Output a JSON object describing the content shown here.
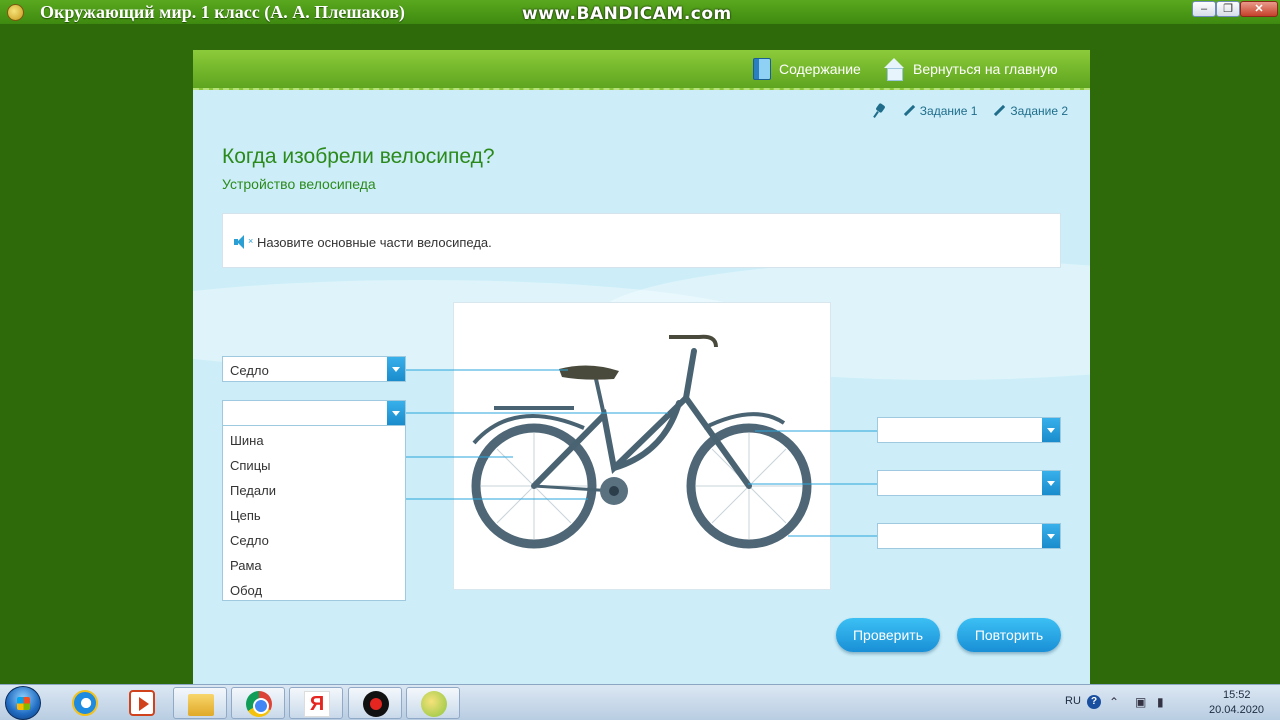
{
  "window": {
    "title": "Окружающий мир. 1 класс (А. А. Плешаков)",
    "watermark": "www.BANDICAM.com",
    "controls": {
      "minimize": "–",
      "maximize": "❐",
      "close": "✕"
    }
  },
  "header": {
    "contents_label": "Содержание",
    "home_label": "Вернуться на главную"
  },
  "task_nav": {
    "items": [
      {
        "label": "Задание 1"
      },
      {
        "label": "Задание 2"
      }
    ]
  },
  "lesson": {
    "title": "Когда изобрели велосипед?",
    "subtitle": "Устройство велосипеда"
  },
  "task": {
    "instruction": "Назовите основные части велосипеда.",
    "mute_mark": "×"
  },
  "selects": {
    "left": [
      {
        "value": "Седло"
      },
      {
        "value": ""
      }
    ],
    "right": [
      {
        "value": ""
      },
      {
        "value": ""
      },
      {
        "value": ""
      }
    ]
  },
  "dropdown": {
    "options": [
      "Шина",
      "Спицы",
      "Педали",
      "Цепь",
      "Седло",
      "Рама",
      "Обод"
    ]
  },
  "buttons": {
    "check": "Проверить",
    "repeat": "Повторить"
  },
  "taskbar": {
    "yandex_letter": "Я",
    "lang": "RU",
    "help": "?",
    "time": "15:52",
    "date": "20.04.2020"
  },
  "colors": {
    "frame": "#2e6a0a",
    "header": "#6fb629",
    "content_bg": "#cdeef8",
    "heading": "#2c8a1c",
    "accent": "#2a9fd4"
  }
}
